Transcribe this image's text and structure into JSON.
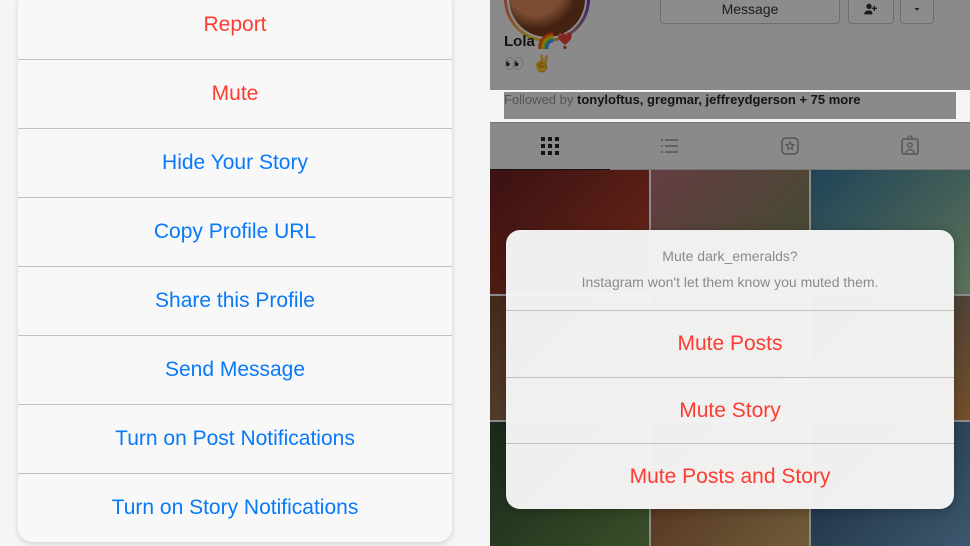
{
  "left_sheet": {
    "items": [
      {
        "label": "Report",
        "style": "red"
      },
      {
        "label": "Mute",
        "style": "red"
      },
      {
        "label": "Hide Your Story",
        "style": "blue"
      },
      {
        "label": "Copy Profile URL",
        "style": "blue"
      },
      {
        "label": "Share this Profile",
        "style": "blue"
      },
      {
        "label": "Send Message",
        "style": "blue"
      },
      {
        "label": "Turn on Post Notifications",
        "style": "blue"
      },
      {
        "label": "Turn on Story Notifications",
        "style": "blue"
      }
    ]
  },
  "right_profile": {
    "message_button": "Message",
    "display_name": "Lola",
    "name_emoji": "🌈❣️",
    "bio_line2": "👀 ✌️",
    "followed_prefix": "Followed by ",
    "followed_names": "tonyloftus, gregmar, jeffreydgerson",
    "followed_suffix": " + 75 more"
  },
  "mute_sheet": {
    "title": "Mute dark_emeralds?",
    "subtitle": "Instagram won't let them know you muted them.",
    "items": [
      {
        "label": "Mute Posts"
      },
      {
        "label": "Mute Story"
      },
      {
        "label": "Mute Posts and Story"
      }
    ]
  }
}
